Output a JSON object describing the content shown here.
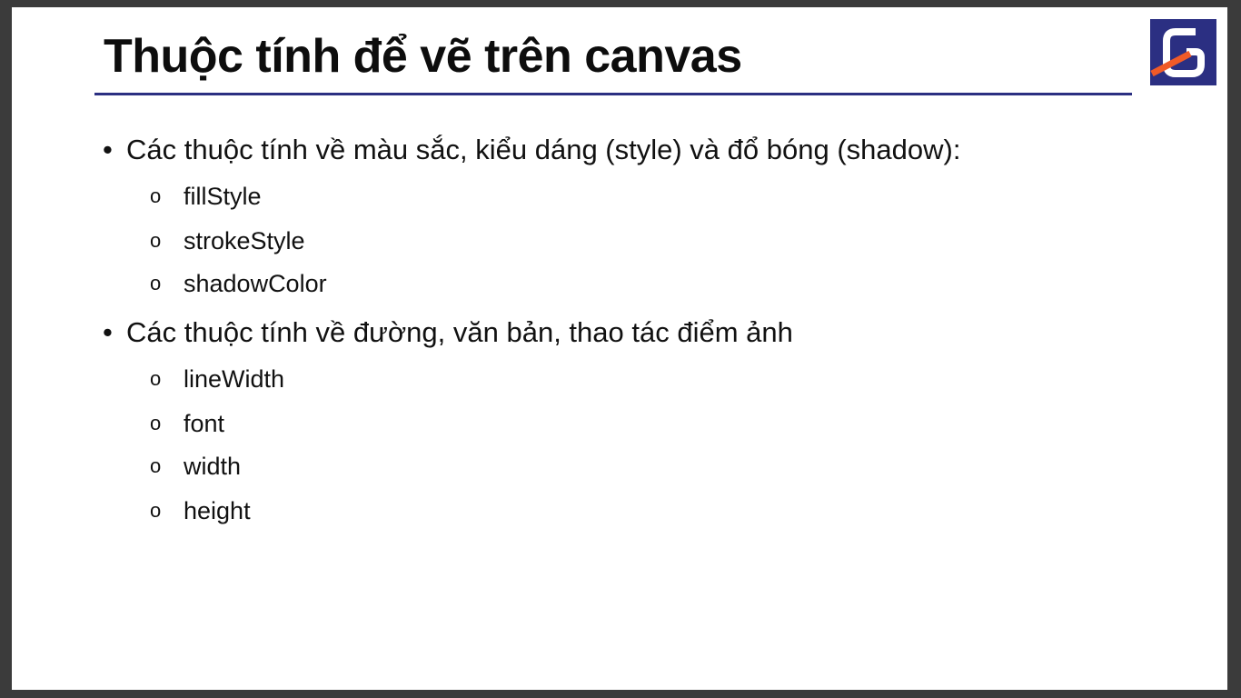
{
  "slide": {
    "title": "Thuộc tính để vẽ trên canvas",
    "logo_icon": "g-logo-icon",
    "accent_color": "#2b2f82",
    "logo_stripe_color": "#f05a28",
    "sections": [
      {
        "bullet": "•",
        "text": "Các thuộc tính về màu sắc, kiểu dáng (style) và đổ bóng (shadow):",
        "items": [
          {
            "marker": "o",
            "text": "fillStyle"
          },
          {
            "marker": "o",
            "text": "strokeStyle"
          },
          {
            "marker": "o",
            "text": "shadowColor"
          }
        ]
      },
      {
        "bullet": "•",
        "text": "Các thuộc tính về đường, văn bản, thao tác điểm ảnh",
        "items": [
          {
            "marker": "o",
            "text": "lineWidth"
          },
          {
            "marker": "o",
            "text": "font"
          },
          {
            "marker": "o",
            "text": "width"
          },
          {
            "marker": "o",
            "text": "height"
          }
        ]
      }
    ]
  }
}
